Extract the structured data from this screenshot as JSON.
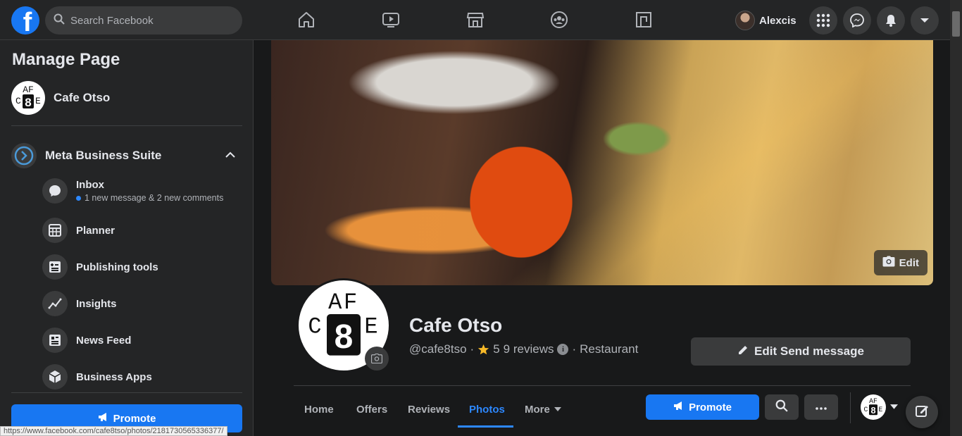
{
  "colors": {
    "brand": "#1877f2",
    "accent_blue": "#2d88ff",
    "bg": "#18191a",
    "surface": "#242526",
    "chip": "#3a3b3c",
    "star": "#f7b928"
  },
  "topbar": {
    "logo_letter": "f",
    "search_placeholder": "Search Facebook",
    "nav_icons": [
      "home-icon",
      "watch-icon",
      "marketplace-icon",
      "groups-icon",
      "gaming-icon"
    ],
    "profile_name": "Alexcis",
    "right_icons": [
      "menu-grid-icon",
      "messenger-icon",
      "notifications-icon",
      "account-caret-icon"
    ]
  },
  "sidebar": {
    "title": "Manage Page",
    "page_name": "Cafe Otso",
    "logo_text": {
      "top": "AF",
      "left": "C",
      "right": "E",
      "center": "8"
    },
    "suite": {
      "label": "Meta Business Suite",
      "icon": "meta-business-suite-icon"
    },
    "items": [
      {
        "label": "Inbox",
        "sub": "1 new message & 2 new comments",
        "icon": "inbox-icon"
      },
      {
        "label": "Planner",
        "icon": "planner-icon"
      },
      {
        "label": "Publishing tools",
        "icon": "publishing-tools-icon"
      },
      {
        "label": "Insights",
        "icon": "insights-icon"
      },
      {
        "label": "News Feed",
        "icon": "news-feed-icon"
      },
      {
        "label": "Business Apps",
        "icon": "business-apps-icon"
      }
    ],
    "promote_label": "Promote"
  },
  "status_url": "https://www.facebook.com/cafe8tso/photos/2181730565336377/",
  "page": {
    "cover_edit_label": "Edit",
    "name": "Cafe Otso",
    "handle": "@cafe8tso",
    "rating": "5",
    "reviews": "9 reviews",
    "category": "Restaurant",
    "edit_send_label": "Edit Send message",
    "tabs": [
      "Home",
      "Offers",
      "Reviews",
      "Photos",
      "More"
    ],
    "active_tab": "Photos",
    "promote_label": "Promote"
  }
}
